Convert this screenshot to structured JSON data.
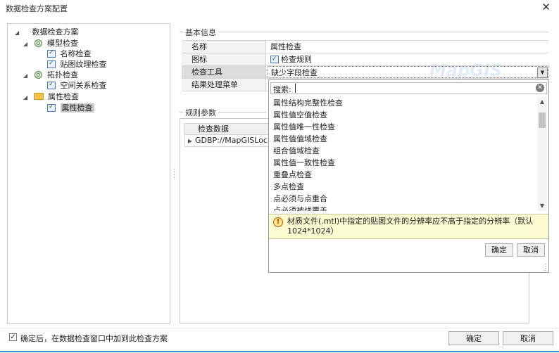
{
  "window": {
    "title": "数据检查方案配置",
    "close": "✕"
  },
  "tree": {
    "root": "数据检查方案",
    "groups": [
      {
        "label": "模型检查",
        "items": [
          "名称检查",
          "贴图纹理检查"
        ]
      },
      {
        "label": "拓扑检查",
        "items": [
          "空间关系检查"
        ]
      },
      {
        "label": "属性检查",
        "items": [
          "属性检查"
        ]
      }
    ]
  },
  "basic_info": {
    "title": "基本信息",
    "rows": [
      {
        "key": "名称",
        "value": "属性检查"
      },
      {
        "key": "图标",
        "value": "检查规则"
      },
      {
        "key": "检查工具",
        "value": "缺少字段检查"
      },
      {
        "key": "结果处理菜单",
        "value": ""
      }
    ]
  },
  "rule_params": {
    "title": "规则参数",
    "header": "检查数据",
    "row_value": "GDBP://MapGISLocal"
  },
  "dropdown": {
    "search_label": "搜索:",
    "search_value": "",
    "items": [
      "属性结构完整性检查",
      "属性值空值检查",
      "属性值唯一性检查",
      "属性值值域检查",
      "组合值域检查",
      "属性值一致性检查",
      "重叠点检查",
      "多点检查",
      "点必须与点重合",
      "点必须被线覆盖"
    ],
    "description": "材质文件(.mtl)中指定的贴图文件的分辨率应不高于指定的分辨率（默认1024*1024）",
    "ok_label": "确定",
    "cancel_label": "取消"
  },
  "footer": {
    "checkbox_checked": true,
    "checkbox_label": "确定后，在数据检查窗口中加到此检查方案",
    "ok_label": "确定",
    "cancel_label": "取消"
  },
  "watermark": {
    "text": "MapGIS"
  },
  "colors": {
    "accent": "#3a8fd6",
    "tooltip_bg": "#fbfbd2",
    "selected": "#c9c9c9"
  }
}
